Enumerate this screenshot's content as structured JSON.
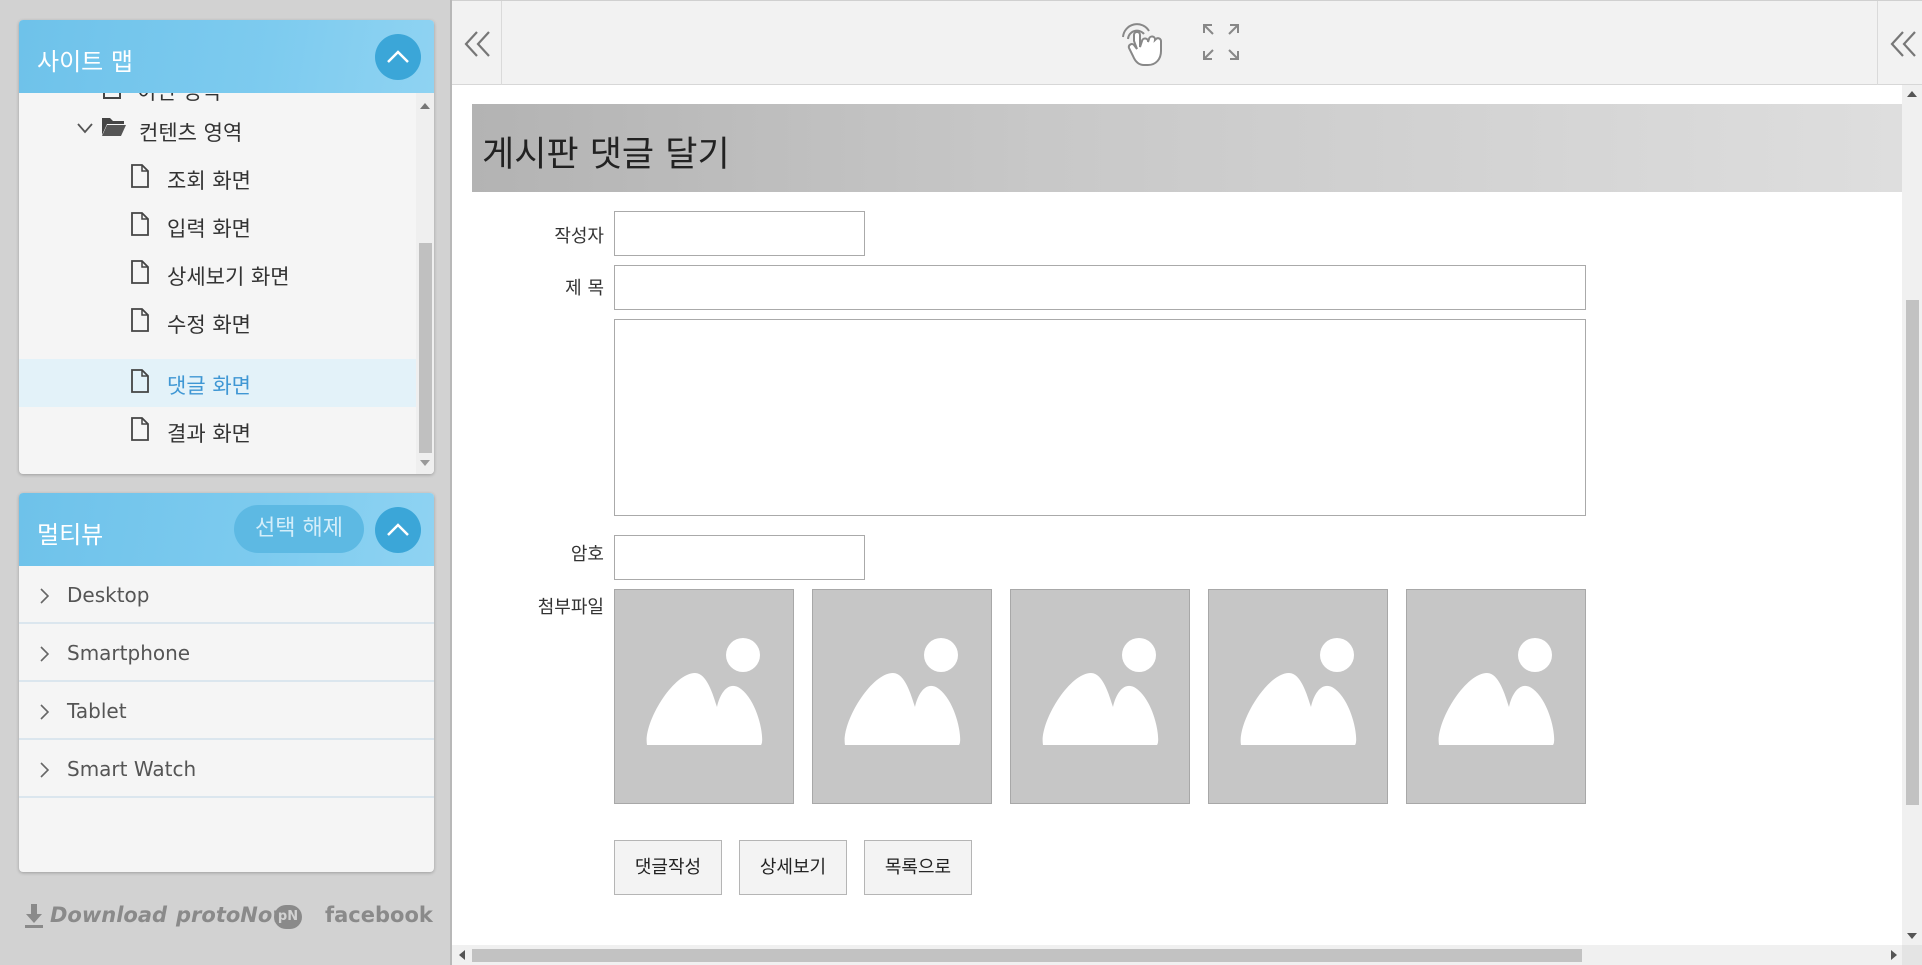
{
  "sitemap": {
    "title": "사이트 맵",
    "items": [
      {
        "label": "이전 영역",
        "type": "file-partial"
      },
      {
        "label": "컨텐츠 영역",
        "type": "folder-open"
      },
      {
        "label": "조회 화면",
        "type": "file"
      },
      {
        "label": "입력 화면",
        "type": "file"
      },
      {
        "label": "상세보기 화면",
        "type": "file"
      },
      {
        "label": "수정 화면",
        "type": "file"
      },
      {
        "label": "댓글 화면",
        "type": "file",
        "active": true
      },
      {
        "label": "결과 화면",
        "type": "file"
      }
    ]
  },
  "multiview": {
    "title": "멀티뷰",
    "deselect_label": "선택 해제",
    "items": [
      {
        "label": "Desktop"
      },
      {
        "label": "Smartphone"
      },
      {
        "label": "Tablet"
      },
      {
        "label": "Smart Watch"
      }
    ]
  },
  "footer": {
    "download": "Download",
    "protonow": "protoNow",
    "protonow_badge": "pN",
    "facebook": "facebook"
  },
  "toolbar": {
    "left_icon": "double-chevron-left-icon",
    "touch_icon": "touch-hand-icon",
    "fullscreen_icon": "fullscreen-icon",
    "right_icon": "double-chevron-left-icon"
  },
  "form": {
    "page_title": "게시판 댓글 달기",
    "author_label": "작성자",
    "author_value": "",
    "subject_label": "제 목",
    "subject_value": "",
    "body_value": "",
    "password_label": "암호",
    "password_value": "",
    "attach_label": "첨부파일",
    "attachments": [
      "image-placeholder-icon",
      "image-placeholder-icon",
      "image-placeholder-icon",
      "image-placeholder-icon",
      "image-placeholder-icon"
    ],
    "buttons": {
      "write_reply": "댓글작성",
      "view_detail": "상세보기",
      "to_list": "목록으로"
    }
  },
  "colors": {
    "panel_header": "#7dcbef",
    "collapse_button": "#3ba6d8",
    "active_item_text": "#3f97d4",
    "active_item_bg": "#e3f2f9"
  }
}
